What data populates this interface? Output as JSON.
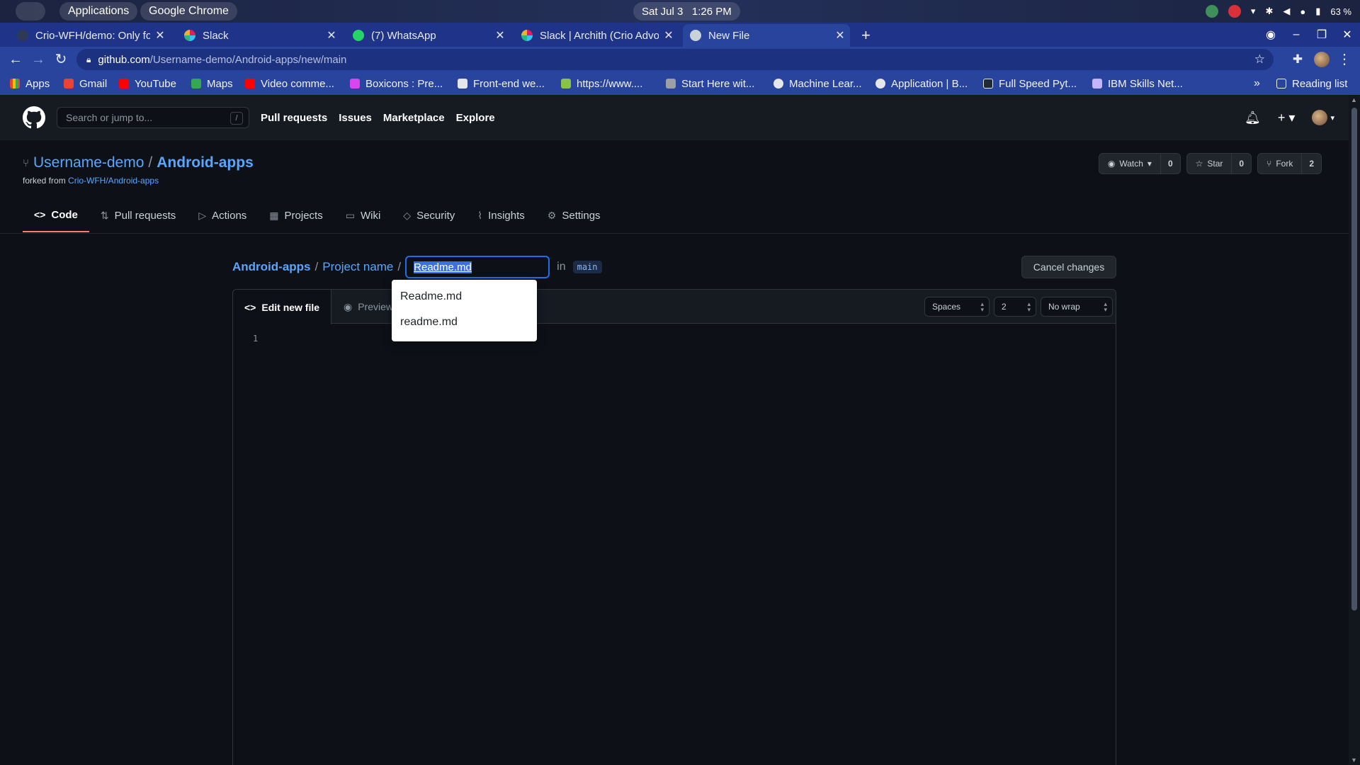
{
  "os": {
    "menu_apps": "Applications",
    "menu_active_app": "Google Chrome",
    "clock": "Sat Jul 3   1:26 PM",
    "battery": "63 %"
  },
  "browser": {
    "tabs": [
      {
        "title": "Crio-WFH/demo: Only for"
      },
      {
        "title": "Slack"
      },
      {
        "title": "(7) WhatsApp"
      },
      {
        "title": "Slack | Archith (Crio Advo"
      },
      {
        "title": "New File"
      }
    ],
    "url_host": "github.com",
    "url_path": "/Username-demo/Android-apps/new/main",
    "bookmarks": [
      "Apps",
      "Gmail",
      "YouTube",
      "Maps",
      "Video comme...",
      "Boxicons : Pre...",
      "Front-end we...",
      "https://www....",
      "Start Here wit...",
      "Machine Lear...",
      "Application | B...",
      "Full Speed Pyt...",
      "IBM Skills Net..."
    ],
    "bookmarks_more": "»",
    "reading_list": "Reading list"
  },
  "github": {
    "search_placeholder": "Search or jump to...",
    "search_shortcut": "/",
    "nav": [
      "Pull requests",
      "Issues",
      "Marketplace",
      "Explore"
    ],
    "repo_owner": "Username-demo",
    "repo_sep": "/",
    "repo_name": "Android-apps",
    "forked_prefix": "forked from",
    "forked_source": "Crio-WFH/Android-apps",
    "watch_label": "Watch",
    "watch_count": "0",
    "star_label": "Star",
    "star_count": "0",
    "fork_label": "Fork",
    "fork_count": "2",
    "repo_tabs": [
      "Code",
      "Pull requests",
      "Actions",
      "Projects",
      "Wiki",
      "Security",
      "Insights",
      "Settings"
    ],
    "repo_tab_icons": [
      "code-icon",
      "pull-request-icon",
      "play-icon",
      "project-icon",
      "book-icon",
      "shield-icon",
      "graph-icon",
      "gear-icon"
    ]
  },
  "editor": {
    "crumb_root": "Android-apps",
    "crumb_sep1": "/",
    "crumb_dir": "Project name",
    "crumb_sep2": "/",
    "filename_value": "Readme.md",
    "in_label": "in",
    "branch": "main",
    "cancel_label": "Cancel changes",
    "tab_edit": "Edit new file",
    "tab_preview": "Preview",
    "indent_mode": "Spaces",
    "indent_size": "2",
    "wrap_mode": "No wrap",
    "line_number": "1",
    "suggestions": [
      "Readme.md",
      "readme.md"
    ]
  }
}
